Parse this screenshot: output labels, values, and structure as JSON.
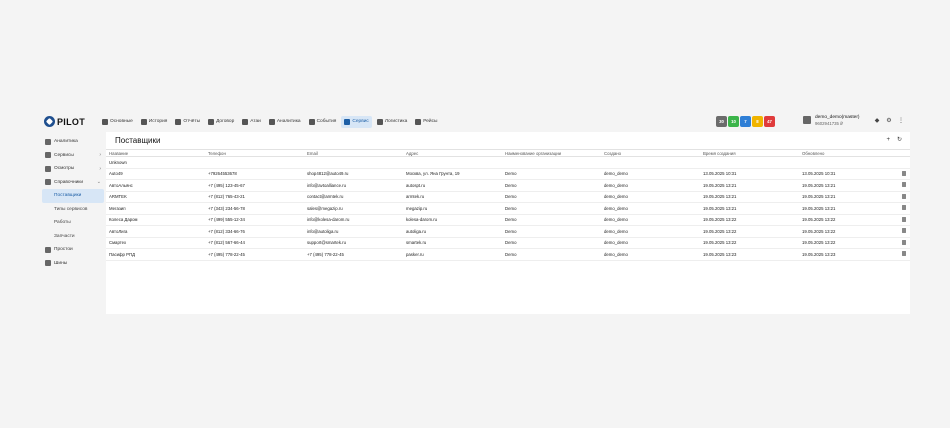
{
  "brand": {
    "name": "PILOT"
  },
  "nav": [
    {
      "label": "Основные",
      "icon": "home-icon",
      "active": false
    },
    {
      "label": "История",
      "icon": "history-icon",
      "active": false
    },
    {
      "label": "Отчёты",
      "icon": "report-icon",
      "active": false
    },
    {
      "label": "Договор",
      "icon": "contract-icon",
      "active": false
    },
    {
      "label": "Атаи",
      "icon": "tools-icon",
      "active": false
    },
    {
      "label": "Аналитика",
      "icon": "analytics-icon",
      "active": false
    },
    {
      "label": "События",
      "icon": "bell-icon",
      "active": false
    },
    {
      "label": "Сервис",
      "icon": "wrench-icon",
      "active": true
    },
    {
      "label": "Логистика",
      "icon": "truck-icon",
      "active": false
    },
    {
      "label": "Рейсы",
      "icon": "bus-icon",
      "active": false
    }
  ],
  "badges": [
    {
      "value": "30",
      "color": "#6b6b6b"
    },
    {
      "value": "10",
      "color": "#3cb54a"
    },
    {
      "value": "7",
      "color": "#2f7fd6"
    },
    {
      "value": "8",
      "color": "#f0b400"
    },
    {
      "value": "47",
      "color": "#e03b3b"
    }
  ],
  "user": {
    "name": "demo_demo(master)",
    "balance": "9602941735 ₽"
  },
  "sidebar": {
    "items": [
      {
        "label": "Аналитика",
        "icon": "chart-icon",
        "chevron": ""
      },
      {
        "label": "Сервисы",
        "icon": "services-icon",
        "chevron": "›"
      },
      {
        "label": "Осмотры",
        "icon": "inspection-icon",
        "chevron": "›"
      },
      {
        "label": "Справочники",
        "icon": "directory-icon",
        "chevron": "⌄"
      }
    ],
    "sub_items": [
      {
        "label": "Поставщики",
        "active": true
      },
      {
        "label": "Типы сервисов",
        "active": false
      },
      {
        "label": "Работы",
        "active": false
      },
      {
        "label": "Запчасти",
        "active": false
      }
    ],
    "bottom_items": [
      {
        "label": "Простои",
        "icon": "pause-icon"
      },
      {
        "label": "Шины",
        "icon": "tire-icon"
      }
    ]
  },
  "page": {
    "title": "Поставщики"
  },
  "table": {
    "columns": [
      "Название",
      "Телефон",
      "Email",
      "Адрес",
      "Наименование организации",
      "Создано",
      "Время создания",
      "Обновлено"
    ],
    "rows": [
      [
        "Unknown",
        "",
        "",
        "",
        "",
        "",
        "",
        ""
      ],
      [
        "Auto49",
        "+79264553678",
        "shop4812@auto49.ru",
        "Москва, ул. Яна Грунта, 19",
        "Demo",
        "demo_demo",
        "13.05.2025 10:31",
        "13.05.2025 10:31"
      ],
      [
        "АвтоАльянс",
        "+7 (495) 123-45-67",
        "info@avtoalliance.ru",
        "autospt.ru",
        "Demo",
        "demo_demo",
        "19.05.2025 13:21",
        "19.05.2025 13:21"
      ],
      [
        "ARMTEK",
        "+7 (812) 765-43-21",
        "contact@armtek.ru",
        "armtek.ru",
        "Demo",
        "demo_demo",
        "19.05.2025 13:21",
        "19.05.2025 13:21"
      ],
      [
        "Мегазип",
        "+7 (343) 234-56-78",
        "sales@megazip.ru",
        "megazip.ru",
        "Demo",
        "demo_demo",
        "19.05.2025 13:21",
        "19.05.2025 13:21"
      ],
      [
        "Колеса Даром",
        "+7 (499) 555-12-34",
        "info@kolesa-darom.ru",
        "kolesa-darom.ru",
        "Demo",
        "demo_demo",
        "19.05.2025 13:22",
        "19.05.2025 13:22"
      ],
      [
        "АвтоЛига",
        "+7 (812) 334-66-76",
        "info@autoliga.ru",
        "autoliga.ru",
        "Demo",
        "demo_demo",
        "19.05.2025 13:22",
        "19.05.2025 13:22"
      ],
      [
        "Смартех",
        "+7 (812) 567-66-44",
        "support@smartek.ru",
        "smartek.ru",
        "Demo",
        "demo_demo",
        "19.05.2025 13:22",
        "19.05.2025 13:22"
      ],
      [
        "Пасифр РПД",
        "+7 (495) 778-22-45",
        "+7 (495) 778-22-45",
        "pasker.ru",
        "Demo",
        "demo_demo",
        "19.05.2025 13:23",
        "19.05.2025 13:23"
      ]
    ]
  }
}
